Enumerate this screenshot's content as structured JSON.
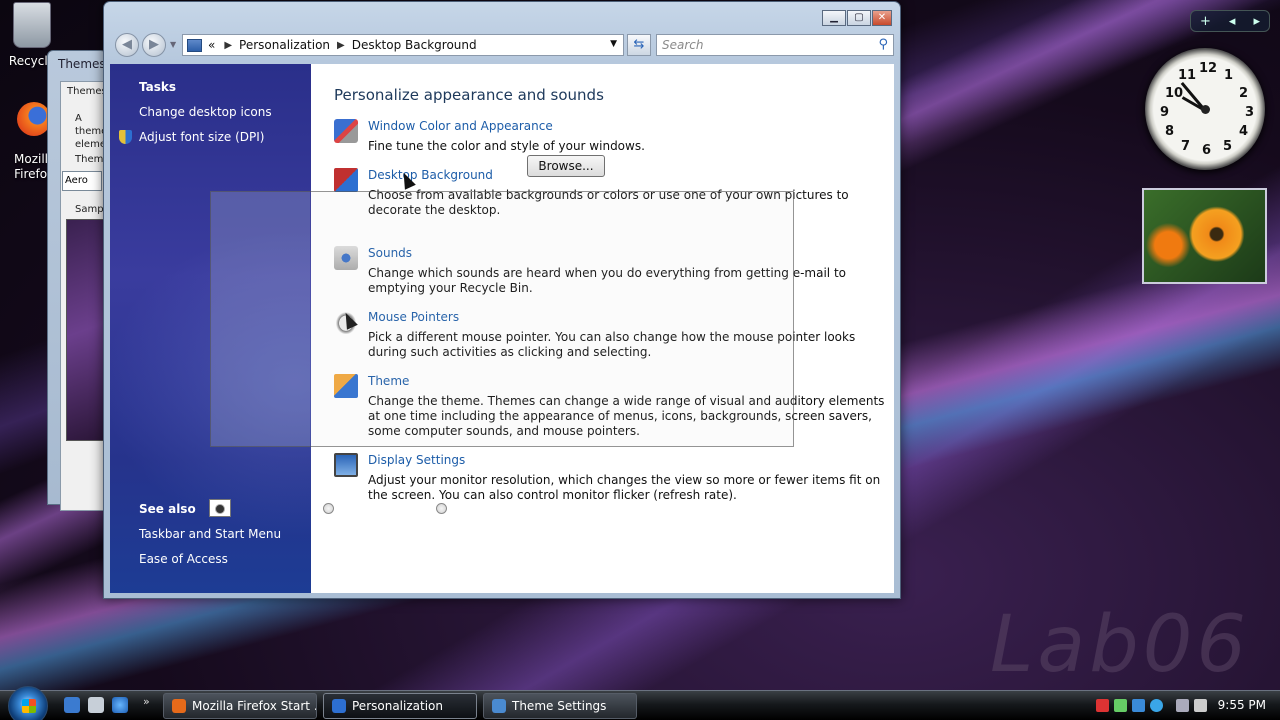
{
  "desktop": {
    "icons": [
      {
        "label": "Recycle"
      },
      {
        "label": "Mozilla Firefox"
      }
    ],
    "watermark": "Lab06"
  },
  "theme_window": {
    "title": "Themes",
    "tab": "Themes",
    "desc": "A theme elements",
    "theme_label": "Theme",
    "theme_value": "Aero",
    "sample_label": "Sample"
  },
  "window": {
    "controls": {
      "minimize": "▁",
      "maximize": "▢",
      "close": "✕"
    },
    "breadcrumb": {
      "prefix": "«",
      "items": [
        "Personalization",
        "Desktop Background"
      ]
    },
    "search_placeholder": "Search"
  },
  "sidebar": {
    "tasks_heading": "Tasks",
    "tasks": [
      "Change desktop icons",
      "Adjust font size (DPI)"
    ],
    "see_also_heading": "See also",
    "see_also": [
      "Taskbar and Start Menu",
      "Ease of Access"
    ]
  },
  "content": {
    "heading": "Personalize appearance and sounds",
    "items": [
      {
        "title": "Window Color and Appearance",
        "desc": "Fine tune the color and style of your windows.",
        "icon": "window-color-icon"
      },
      {
        "title": "Desktop Background",
        "desc": "Choose from available backgrounds or colors or use one of your own pictures to decorate the desktop.",
        "icon": "desktop-background-icon"
      },
      {
        "title": "Sounds",
        "desc": "Change which sounds are heard when you do everything from getting e-mail to emptying your Recycle Bin.",
        "icon": "sounds-icon"
      },
      {
        "title": "Mouse Pointers",
        "desc": "Pick a different mouse pointer. You can also change how the mouse pointer looks during such activities as clicking and selecting.",
        "icon": "mouse-pointers-icon"
      },
      {
        "title": "Theme",
        "desc": "Change the theme. Themes can change a wide range of visual and auditory elements at one time including the appearance of menus, icons, backgrounds, screen savers, some computer sounds, and mouse pointers.",
        "icon": "theme-icon"
      },
      {
        "title": "Display Settings",
        "desc": "Adjust your monitor resolution, which changes the view so more or fewer items fit on the screen. You can also control monitor flicker (refresh rate).",
        "icon": "display-settings-icon"
      }
    ],
    "browse_label": "Browse..."
  },
  "gadgets": {
    "bar": [
      "+",
      "◂",
      "▸"
    ],
    "clock_numbers": [
      "12",
      "1",
      "2",
      "3",
      "4",
      "5",
      "6",
      "7",
      "8",
      "9",
      "10",
      "11"
    ]
  },
  "taskbar": {
    "buttons": [
      {
        "label": "Mozilla Firefox Start ...",
        "color": "#e66a1a"
      },
      {
        "label": "Personalization",
        "color": "#2d6fd1"
      },
      {
        "label": "Theme Settings",
        "color": "#4a8ad0"
      }
    ],
    "time": "9:55 PM"
  }
}
